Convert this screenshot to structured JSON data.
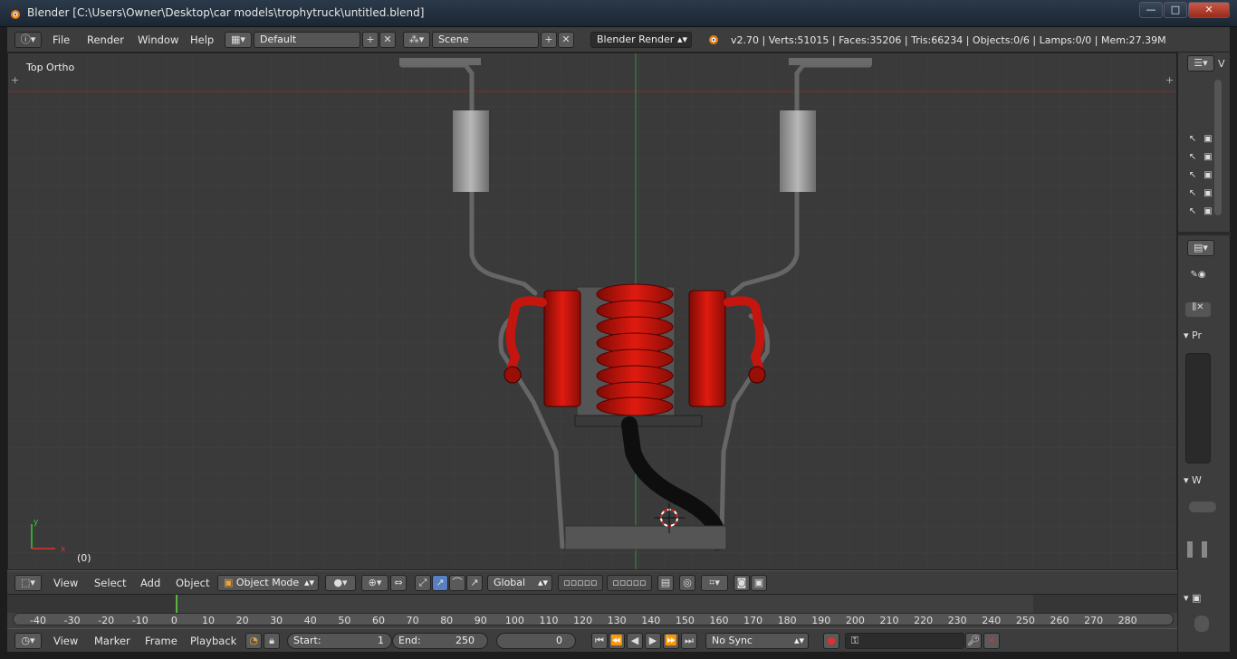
{
  "window": {
    "title": "Blender [C:\\Users\\Owner\\Desktop\\car models\\trophytruck\\untitled.blend]",
    "minimize": "—",
    "maximize": "□",
    "close": "✕"
  },
  "info_header": {
    "menus": [
      "File",
      "Render",
      "Window",
      "Help"
    ],
    "layout": "Default",
    "scene": "Scene",
    "engine": "Blender Render",
    "stats": "v2.70 | Verts:51015 | Faces:35206 | Tris:66234 | Objects:0/6 | Lamps:0/0 | Mem:27.39M"
  },
  "viewport": {
    "view_name": "Top Ortho",
    "frame_label": "(0)",
    "axis_x": "x",
    "axis_y": "y"
  },
  "view3d_header": {
    "menus": [
      "View",
      "Select",
      "Add",
      "Object"
    ],
    "mode": "Object Mode",
    "orientation": "Global"
  },
  "timeline": {
    "ticks": [
      "-40",
      "-30",
      "-20",
      "-10",
      "0",
      "10",
      "20",
      "30",
      "40",
      "50",
      "60",
      "70",
      "80",
      "90",
      "100",
      "110",
      "120",
      "130",
      "140",
      "150",
      "160",
      "170",
      "180",
      "190",
      "200",
      "210",
      "220",
      "230",
      "240",
      "250",
      "260",
      "270",
      "280"
    ],
    "current_frame_marker": 0
  },
  "timeline_header": {
    "menus": [
      "View",
      "Marker",
      "Frame",
      "Playback"
    ],
    "start_label": "Start:",
    "start_value": "1",
    "end_label": "End:",
    "end_value": "250",
    "current_frame": "0",
    "sync": "No Sync"
  },
  "properties_panel": {
    "pr_label": "Pr",
    "w_label": "W",
    "v_label": "V"
  },
  "colors": {
    "engine_red": "#c4160e",
    "grid_bg": "#3a3a3a",
    "header_bg": "#3d3d3d",
    "x_axis_line": "#8a2a2a",
    "y_axis_line": "#3f8a3f"
  }
}
